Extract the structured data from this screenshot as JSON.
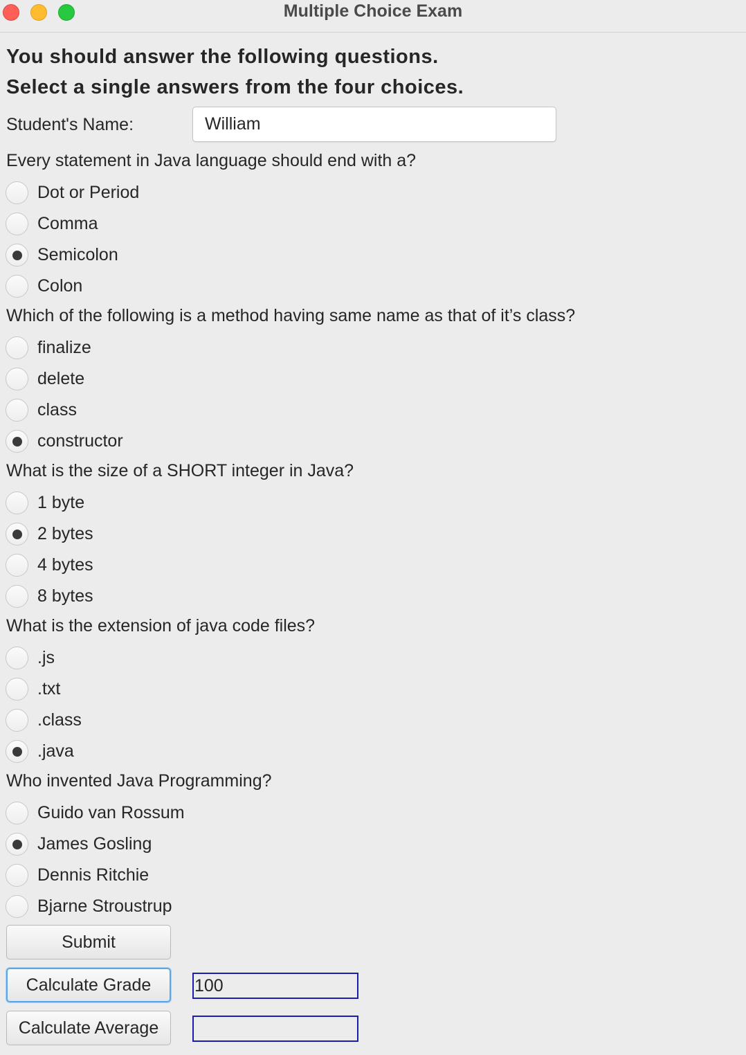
{
  "window": {
    "title": "Multiple Choice Exam"
  },
  "instructions": {
    "line1": "You should answer the following questions.",
    "line2": "Select a single answers from the four choices."
  },
  "student": {
    "label": "Student's Name:",
    "value": "William"
  },
  "questions": [
    {
      "text": "Every statement in Java language should end with a?",
      "options": [
        {
          "label": "Dot or Period",
          "selected": false
        },
        {
          "label": "Comma",
          "selected": false
        },
        {
          "label": "Semicolon",
          "selected": true
        },
        {
          "label": "Colon",
          "selected": false
        }
      ]
    },
    {
      "text": "Which of the following is a method having same name as that of it’s class?",
      "options": [
        {
          "label": "finalize",
          "selected": false
        },
        {
          "label": "delete",
          "selected": false
        },
        {
          "label": "class",
          "selected": false
        },
        {
          "label": "constructor",
          "selected": true
        }
      ]
    },
    {
      "text": "What is the size of a SHORT integer in Java?",
      "options": [
        {
          "label": "1 byte",
          "selected": false
        },
        {
          "label": "2 bytes",
          "selected": true
        },
        {
          "label": "4 bytes",
          "selected": false
        },
        {
          "label": "8 bytes",
          "selected": false
        }
      ]
    },
    {
      "text": "What is the extension of java code files?",
      "options": [
        {
          "label": ".js",
          "selected": false
        },
        {
          "label": ".txt",
          "selected": false
        },
        {
          "label": ".class",
          "selected": false
        },
        {
          "label": ".java",
          "selected": true
        }
      ]
    },
    {
      "text": "Who invented Java Programming?",
      "options": [
        {
          "label": "Guido van Rossum",
          "selected": false
        },
        {
          "label": "James Gosling",
          "selected": true
        },
        {
          "label": "Dennis Ritchie",
          "selected": false
        },
        {
          "label": "Bjarne Stroustrup",
          "selected": false
        }
      ]
    }
  ],
  "actions": {
    "submit_label": "Submit",
    "calculate_grade_label": "Calculate Grade",
    "calculate_average_label": "Calculate Average",
    "grade_value": "100",
    "average_value": ""
  }
}
